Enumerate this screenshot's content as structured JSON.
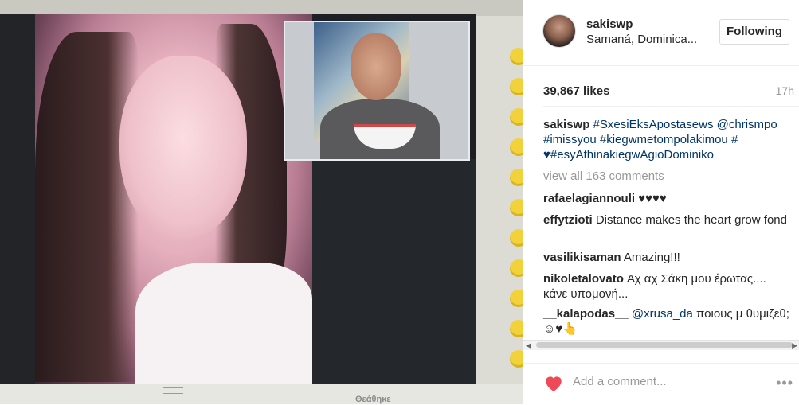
{
  "photo": {
    "seen_label": "Θεάθηκε"
  },
  "post": {
    "username": "sakiswp",
    "location": "Samaná, Dominica...",
    "follow_label": "Following",
    "likes": "39,867 likes",
    "time": "17h",
    "caption": {
      "username": "sakiswp",
      "parts": [
        "#SxesiEksApostasews",
        "@chrismpo",
        "#imissyou",
        "#kiegwmetompolakimou",
        "#",
        "♥#esyAthinakiegwAgioDominiko"
      ]
    },
    "view_all": "view all 163 comments",
    "comments": [
      {
        "username": "rafaelagiannouli",
        "text": "♥♥♥♥"
      },
      {
        "username": "effytzioti",
        "text": "Distance makes the heart grow fond"
      },
      {
        "username": "vasilikisaman",
        "text": "Amazing!!!"
      },
      {
        "username": "nikoletalovato",
        "text": "Αχ αχ Σάκη μου έρωτας.... κάνε υπομονή..."
      },
      {
        "username": "__kalapodas__",
        "mention": "@xrusa_da",
        "text": "ποιους μ θυμιζεθ;☺♥👆"
      }
    ],
    "add_comment_placeholder": "Add a comment...",
    "more_label": "•••"
  },
  "colors": {
    "link": "#003569",
    "heart": "#ed4956",
    "muted": "#999999"
  },
  "icons": {
    "heart": "heart-icon",
    "more": "more-options-icon"
  }
}
